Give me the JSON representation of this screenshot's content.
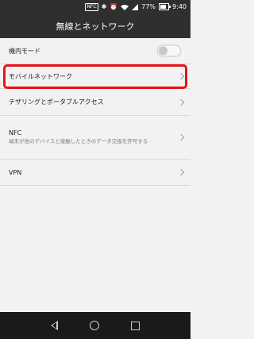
{
  "status_bar": {
    "nfc_label": "NFC",
    "battery_percent": "77%",
    "battery_level": 0.77,
    "time": "9:40",
    "icons": [
      "nfc-icon",
      "bluetooth-off-icon",
      "alarm-icon",
      "wifi-icon",
      "signal-icon",
      "battery-icon"
    ]
  },
  "header": {
    "title": "無線とネットワーク"
  },
  "settings": {
    "items": [
      {
        "title": "機内モード",
        "control": "toggle",
        "toggle_on": false
      },
      {
        "title": "モバイルネットワーク",
        "control": "chevron",
        "highlighted": true
      },
      {
        "title": "テザリングとポータブルアクセス",
        "control": "chevron"
      },
      {
        "title": "NFC",
        "subtitle": "端末が他のデバイスと接触したときのデータ交換を許可する",
        "control": "chevron"
      },
      {
        "title": "VPN",
        "control": "chevron"
      }
    ]
  },
  "colors": {
    "header_bg": "#2f2f2f",
    "page_bg": "#f2f2f2",
    "highlight": "#e8111b",
    "navbar_bg": "#1a1a1a"
  },
  "nav_bar": {
    "icons": [
      "back-icon",
      "home-icon",
      "recent-apps-icon"
    ]
  }
}
